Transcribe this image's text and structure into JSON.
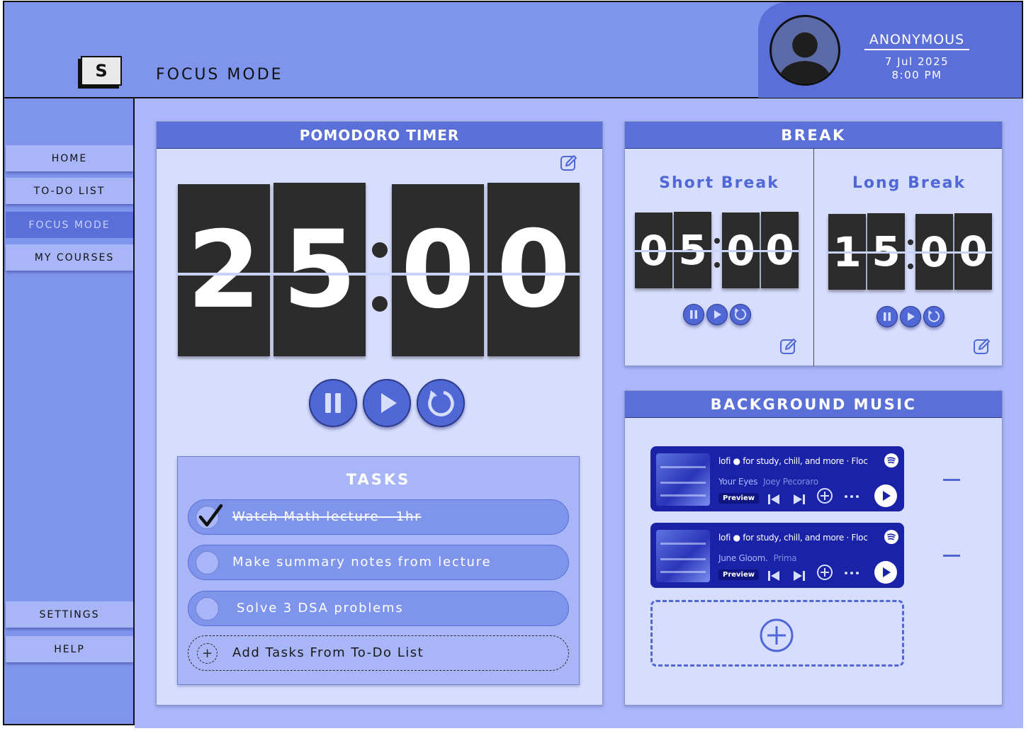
{
  "app": {
    "logo_letter": "S"
  },
  "sidebar": {
    "items": [
      {
        "label": "HOME"
      },
      {
        "label": "TO-DO LIST"
      },
      {
        "label": "FOCUS MODE"
      },
      {
        "label": "MY COURSES"
      }
    ],
    "bottom_items": [
      {
        "label": "SETTINGS"
      },
      {
        "label": "HELP"
      }
    ],
    "active_item": "FOCUS MODE"
  },
  "header": {
    "page_title": "FOCUS MODE",
    "user": {
      "name": "ANONYMOUS",
      "date": "7 Jul 2025",
      "time": "8:00 PM"
    }
  },
  "pomodoro": {
    "title": "POMODORO TIMER",
    "digits": [
      "2",
      "5",
      "0",
      "0"
    ]
  },
  "break": {
    "title": "BREAK",
    "short": {
      "label": "Short Break",
      "digits": [
        "0",
        "5",
        "0",
        "0"
      ]
    },
    "long": {
      "label": "Long Break",
      "digits": [
        "1",
        "5",
        "0",
        "0"
      ]
    }
  },
  "tasks": {
    "title": "TASKS",
    "items": [
      {
        "text": "Watch Math lecture - 1hr",
        "done": true
      },
      {
        "text": "Make summary notes from lecture",
        "done": false
      },
      {
        "text": "Solve 3 DSA problems",
        "done": false
      }
    ],
    "add_label": "Add Tasks From To-Do List"
  },
  "music": {
    "title": "BACKGROUND MUSIC",
    "players": [
      {
        "playlist": "lofi",
        "title": "for study, chill, and more · Floc",
        "song": "Your Eyes",
        "artist": "Joey Pecoraro",
        "preview": "Preview"
      },
      {
        "playlist": "lofi",
        "title": "for study, chill, and more · Floc",
        "song": "June Gloom.",
        "artist": "Prima",
        "preview": "Preview"
      }
    ]
  },
  "colors": {
    "sidebar_bg": "#7f95ec",
    "main_bg": "#abb7fb",
    "panel_bg": "#d6ddfd",
    "accent": "#5b6fd8",
    "flip_card": "#2c2c2c",
    "player_bg": "#1a22a8"
  },
  "icons": [
    "profile-avatar-icon",
    "edit-icon",
    "pause-icon",
    "play-icon",
    "reset-icon",
    "check-icon",
    "plus-icon",
    "minus-icon",
    "spotify-icon",
    "skip-back-icon",
    "skip-forward-icon",
    "more-icon"
  ]
}
